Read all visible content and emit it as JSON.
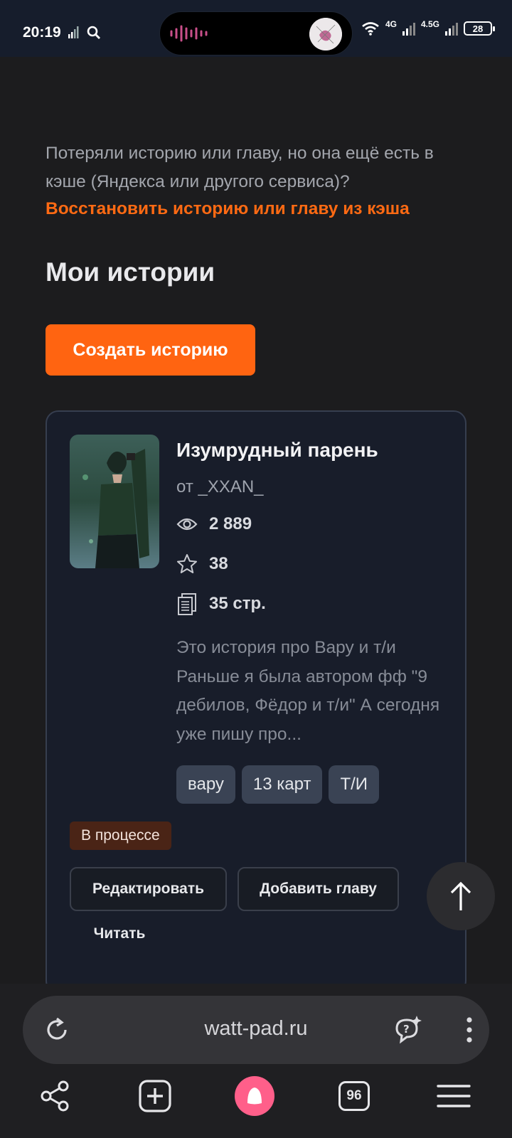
{
  "status_bar": {
    "time": "20:19",
    "network_1": "4G",
    "network_2": "4.5G",
    "battery": "28"
  },
  "cache_notice": {
    "text": "Потеряли историю или главу, но она ещё есть в кэше (Яндекса или другого сервиса)?",
    "link": "Восстановить историю или главу из кэша"
  },
  "section_title": "Мои истории",
  "create_button": "Создать историю",
  "story": {
    "title": "Изумрудный парень",
    "author": "от _XXAN_",
    "views": "2 889",
    "stars": "38",
    "pages": "35 стр.",
    "description": "Это история про Вару и т/и Раньше я была автором фф \"9 дебилов, Фёдор и т/и\" А сегодня уже пишу про...",
    "tags": [
      "вару",
      "13 карт",
      "Т/И"
    ],
    "status": "В процессе",
    "actions": {
      "edit": "Редактировать",
      "add_chapter": "Добавить главу",
      "read": "Читать"
    }
  },
  "browser": {
    "url": "watt-pad.ru",
    "tabs_count": "96"
  },
  "colors": {
    "accent": "#ff6411",
    "background": "#1c1c1e",
    "card": "#181d2a"
  }
}
